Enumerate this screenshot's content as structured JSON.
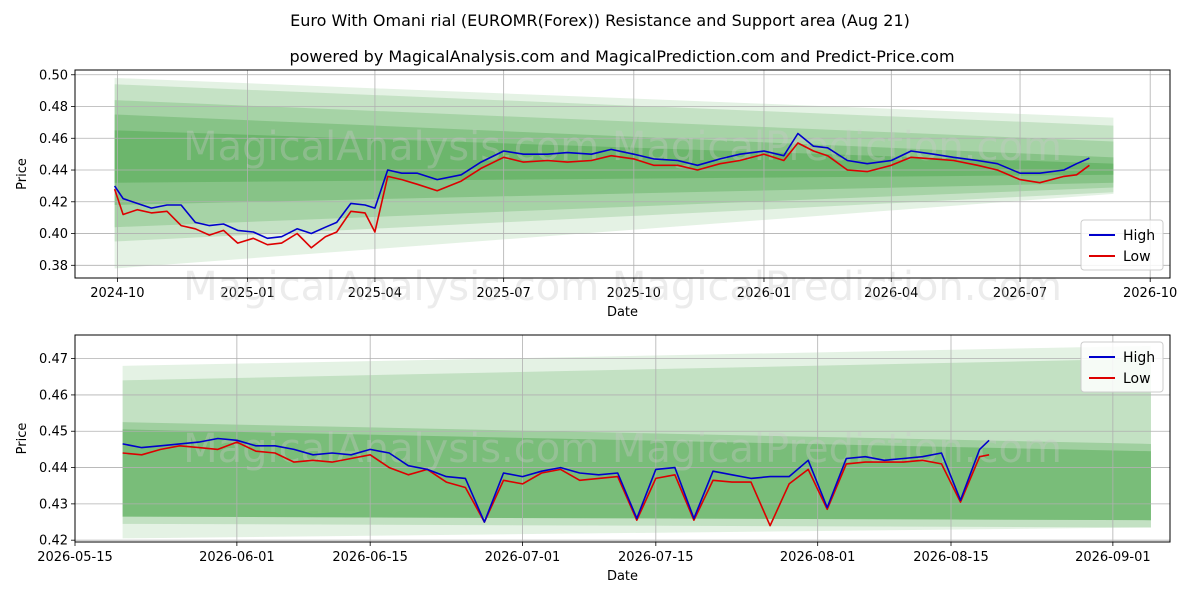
{
  "title": "Euro With Omani rial (EUROMR(Forex)) Resistance and Support area (Aug 21)",
  "subtitle": "powered by MagicalAnalysis.com and MagicalPrediction.com and Predict-Price.com",
  "watermarks": [
    "MagicalAnalysis.com",
    "MagicalPrediction.com"
  ],
  "colors": {
    "high": "#0000cc",
    "low": "#dd0000",
    "band": "#4ca64c",
    "grid": "#b0b0b0"
  },
  "chart_data": [
    {
      "type": "line",
      "xlabel": "Date",
      "ylabel": "Price",
      "x_range": [
        "2024-09-01",
        "2026-10-15"
      ],
      "ylim": [
        0.372,
        0.503
      ],
      "x_ticks": [
        {
          "date": "2024-10-01",
          "label": "2024-10"
        },
        {
          "date": "2025-01-01",
          "label": "2025-01"
        },
        {
          "date": "2025-04-01",
          "label": "2025-04"
        },
        {
          "date": "2025-07-01",
          "label": "2025-07"
        },
        {
          "date": "2025-10-01",
          "label": "2025-10"
        },
        {
          "date": "2026-01-01",
          "label": "2026-01"
        },
        {
          "date": "2026-04-01",
          "label": "2026-04"
        },
        {
          "date": "2026-07-01",
          "label": "2026-07"
        },
        {
          "date": "2026-10-01",
          "label": "2026-10"
        }
      ],
      "y_ticks": [
        "0.38",
        "0.40",
        "0.42",
        "0.44",
        "0.46",
        "0.48",
        "0.50"
      ],
      "legend": {
        "position": "lower-right",
        "entries": [
          "High",
          "Low"
        ]
      },
      "bands": {
        "x_start": "2024-09-29",
        "x_end": "2026-09-05",
        "levels": [
          {
            "top": [
              0.498,
              0.473
            ],
            "bottom": [
              0.378,
              0.425
            ],
            "alpha": 0.15
          },
          {
            "top": [
              0.494,
              0.468
            ],
            "bottom": [
              0.395,
              0.426
            ],
            "alpha": 0.2
          },
          {
            "top": [
              0.484,
              0.458
            ],
            "bottom": [
              0.404,
              0.429
            ],
            "alpha": 0.25
          },
          {
            "top": [
              0.475,
              0.448
            ],
            "bottom": [
              0.418,
              0.432
            ],
            "alpha": 0.35
          },
          {
            "top": [
              0.465,
              0.444
            ],
            "bottom": [
              0.432,
              0.437
            ],
            "alpha": 0.45
          }
        ]
      },
      "series": [
        {
          "name": "High",
          "x": [
            "2024-09-29",
            "2024-10-05",
            "2024-10-15",
            "2024-10-25",
            "2024-11-05",
            "2024-11-15",
            "2024-11-25",
            "2024-12-05",
            "2024-12-15",
            "2024-12-25",
            "2025-01-05",
            "2025-01-15",
            "2025-01-25",
            "2025-02-05",
            "2025-02-15",
            "2025-02-25",
            "2025-03-05",
            "2025-03-15",
            "2025-03-25",
            "2025-04-01",
            "2025-04-10",
            "2025-04-20",
            "2025-05-01",
            "2025-05-15",
            "2025-06-01",
            "2025-06-15",
            "2025-07-01",
            "2025-07-15",
            "2025-08-01",
            "2025-08-15",
            "2025-09-01",
            "2025-09-15",
            "2025-10-01",
            "2025-10-15",
            "2025-11-01",
            "2025-11-15",
            "2025-12-01",
            "2025-12-15",
            "2026-01-01",
            "2026-01-15",
            "2026-01-25",
            "2026-02-05",
            "2026-02-15",
            "2026-03-01",
            "2026-03-15",
            "2026-04-01",
            "2026-04-15",
            "2026-05-01",
            "2026-05-15",
            "2026-06-01",
            "2026-06-15",
            "2026-07-01",
            "2026-07-15",
            "2026-08-01",
            "2026-08-10",
            "2026-08-19"
          ],
          "values": [
            0.43,
            0.422,
            0.419,
            0.416,
            0.418,
            0.418,
            0.407,
            0.405,
            0.406,
            0.402,
            0.401,
            0.397,
            0.398,
            0.403,
            0.4,
            0.404,
            0.407,
            0.419,
            0.418,
            0.416,
            0.44,
            0.438,
            0.438,
            0.434,
            0.437,
            0.445,
            0.452,
            0.45,
            0.45,
            0.451,
            0.45,
            0.453,
            0.45,
            0.447,
            0.446,
            0.443,
            0.447,
            0.45,
            0.452,
            0.449,
            0.463,
            0.455,
            0.454,
            0.446,
            0.444,
            0.446,
            0.452,
            0.45,
            0.448,
            0.446,
            0.444,
            0.438,
            0.438,
            0.44,
            0.444,
            0.4475
          ]
        },
        {
          "name": "Low",
          "x": [
            "2024-09-29",
            "2024-10-05",
            "2024-10-15",
            "2024-10-25",
            "2024-11-05",
            "2024-11-15",
            "2024-11-25",
            "2024-12-05",
            "2024-12-15",
            "2024-12-25",
            "2025-01-05",
            "2025-01-15",
            "2025-01-25",
            "2025-02-05",
            "2025-02-15",
            "2025-02-25",
            "2025-03-05",
            "2025-03-15",
            "2025-03-25",
            "2025-04-01",
            "2025-04-10",
            "2025-04-20",
            "2025-05-01",
            "2025-05-15",
            "2025-06-01",
            "2025-06-15",
            "2025-07-01",
            "2025-07-15",
            "2025-08-01",
            "2025-08-15",
            "2025-09-01",
            "2025-09-15",
            "2025-10-01",
            "2025-10-15",
            "2025-11-01",
            "2025-11-15",
            "2025-12-01",
            "2025-12-15",
            "2026-01-01",
            "2026-01-15",
            "2026-01-25",
            "2026-02-05",
            "2026-02-15",
            "2026-03-01",
            "2026-03-15",
            "2026-04-01",
            "2026-04-15",
            "2026-05-01",
            "2026-05-15",
            "2026-06-01",
            "2026-06-15",
            "2026-07-01",
            "2026-07-15",
            "2026-08-01",
            "2026-08-10",
            "2026-08-19"
          ],
          "values": [
            0.428,
            0.412,
            0.415,
            0.413,
            0.414,
            0.405,
            0.403,
            0.399,
            0.402,
            0.394,
            0.397,
            0.393,
            0.394,
            0.4,
            0.391,
            0.398,
            0.401,
            0.414,
            0.413,
            0.401,
            0.436,
            0.434,
            0.431,
            0.427,
            0.433,
            0.441,
            0.448,
            0.445,
            0.446,
            0.445,
            0.446,
            0.449,
            0.447,
            0.443,
            0.443,
            0.44,
            0.444,
            0.446,
            0.45,
            0.446,
            0.457,
            0.452,
            0.449,
            0.44,
            0.439,
            0.443,
            0.448,
            0.447,
            0.446,
            0.443,
            0.44,
            0.434,
            0.432,
            0.436,
            0.437,
            0.443
          ]
        }
      ]
    },
    {
      "type": "line",
      "xlabel": "Date",
      "ylabel": "Price",
      "x_range": [
        "2026-05-15",
        "2026-09-07"
      ],
      "ylim": [
        0.4195,
        0.4765
      ],
      "x_ticks": [
        {
          "date": "2026-05-15",
          "label": "2026-05-15"
        },
        {
          "date": "2026-06-01",
          "label": "2026-06-01"
        },
        {
          "date": "2026-06-15",
          "label": "2026-06-15"
        },
        {
          "date": "2026-07-01",
          "label": "2026-07-01"
        },
        {
          "date": "2026-07-15",
          "label": "2026-07-15"
        },
        {
          "date": "2026-08-01",
          "label": "2026-08-01"
        },
        {
          "date": "2026-08-15",
          "label": "2026-08-15"
        },
        {
          "date": "2026-09-01",
          "label": "2026-09-01"
        }
      ],
      "y_ticks": [
        "0.42",
        "0.43",
        "0.44",
        "0.45",
        "0.46",
        "0.47"
      ],
      "legend": {
        "position": "upper-right",
        "entries": [
          "High",
          "Low"
        ]
      },
      "bands": {
        "x_start": "2026-05-20",
        "x_end": "2026-09-05",
        "levels": [
          {
            "top": [
              0.468,
              0.4735
            ],
            "bottom": [
              0.4205,
              0.4235
            ],
            "alpha": 0.15
          },
          {
            "top": [
              0.464,
              0.47
            ],
            "bottom": [
              0.4245,
              0.4235
            ],
            "alpha": 0.22
          },
          {
            "top": [
              0.4525,
              0.4465
            ],
            "bottom": [
              0.4265,
              0.4255
            ],
            "alpha": 0.3
          },
          {
            "top": [
              0.4505,
              0.4445
            ],
            "bottom": [
              0.4265,
              0.4255
            ],
            "alpha": 0.45
          }
        ]
      },
      "series": [
        {
          "name": "High",
          "x": [
            "2026-05-20",
            "2026-05-22",
            "2026-05-24",
            "2026-05-26",
            "2026-05-28",
            "2026-05-30",
            "2026-06-01",
            "2026-06-03",
            "2026-06-05",
            "2026-06-07",
            "2026-06-09",
            "2026-06-11",
            "2026-06-13",
            "2026-06-15",
            "2026-06-17",
            "2026-06-19",
            "2026-06-21",
            "2026-06-23",
            "2026-06-25",
            "2026-06-27",
            "2026-06-29",
            "2026-07-01",
            "2026-07-03",
            "2026-07-05",
            "2026-07-07",
            "2026-07-09",
            "2026-07-11",
            "2026-07-13",
            "2026-07-15",
            "2026-07-17",
            "2026-07-19",
            "2026-07-21",
            "2026-07-23",
            "2026-07-25",
            "2026-07-27",
            "2026-07-29",
            "2026-07-31",
            "2026-08-02",
            "2026-08-04",
            "2026-08-06",
            "2026-08-08",
            "2026-08-10",
            "2026-08-12",
            "2026-08-14",
            "2026-08-16",
            "2026-08-18",
            "2026-08-19"
          ],
          "values": [
            0.4465,
            0.4455,
            0.446,
            0.4465,
            0.447,
            0.448,
            0.4475,
            0.446,
            0.446,
            0.445,
            0.4435,
            0.444,
            0.4435,
            0.445,
            0.444,
            0.4405,
            0.4395,
            0.4375,
            0.437,
            0.425,
            0.4385,
            0.4375,
            0.439,
            0.44,
            0.4385,
            0.438,
            0.4385,
            0.426,
            0.4395,
            0.44,
            0.426,
            0.439,
            0.438,
            0.437,
            0.4375,
            0.4375,
            0.442,
            0.429,
            0.4425,
            0.443,
            0.442,
            0.4425,
            0.443,
            0.444,
            0.431,
            0.445,
            0.4475
          ]
        },
        {
          "name": "Low",
          "x": [
            "2026-05-20",
            "2026-05-22",
            "2026-05-24",
            "2026-05-26",
            "2026-05-28",
            "2026-05-30",
            "2026-06-01",
            "2026-06-03",
            "2026-06-05",
            "2026-06-07",
            "2026-06-09",
            "2026-06-11",
            "2026-06-13",
            "2026-06-15",
            "2026-06-17",
            "2026-06-19",
            "2026-06-21",
            "2026-06-23",
            "2026-06-25",
            "2026-06-27",
            "2026-06-29",
            "2026-07-01",
            "2026-07-03",
            "2026-07-05",
            "2026-07-07",
            "2026-07-09",
            "2026-07-11",
            "2026-07-13",
            "2026-07-15",
            "2026-07-17",
            "2026-07-19",
            "2026-07-21",
            "2026-07-23",
            "2026-07-25",
            "2026-07-27",
            "2026-07-29",
            "2026-07-31",
            "2026-08-02",
            "2026-08-04",
            "2026-08-06",
            "2026-08-08",
            "2026-08-10",
            "2026-08-12",
            "2026-08-14",
            "2026-08-16",
            "2026-08-18",
            "2026-08-19"
          ],
          "values": [
            0.444,
            0.4435,
            0.445,
            0.446,
            0.4455,
            0.445,
            0.447,
            0.4445,
            0.444,
            0.4415,
            0.442,
            0.4415,
            0.4425,
            0.4435,
            0.44,
            0.438,
            0.4395,
            0.436,
            0.4345,
            0.425,
            0.4365,
            0.4355,
            0.4385,
            0.4395,
            0.4365,
            0.437,
            0.4375,
            0.4255,
            0.437,
            0.438,
            0.4255,
            0.4365,
            0.436,
            0.436,
            0.424,
            0.4355,
            0.4395,
            0.4285,
            0.441,
            0.4415,
            0.4415,
            0.4415,
            0.442,
            0.441,
            0.4305,
            0.443,
            0.4435
          ]
        }
      ]
    }
  ]
}
